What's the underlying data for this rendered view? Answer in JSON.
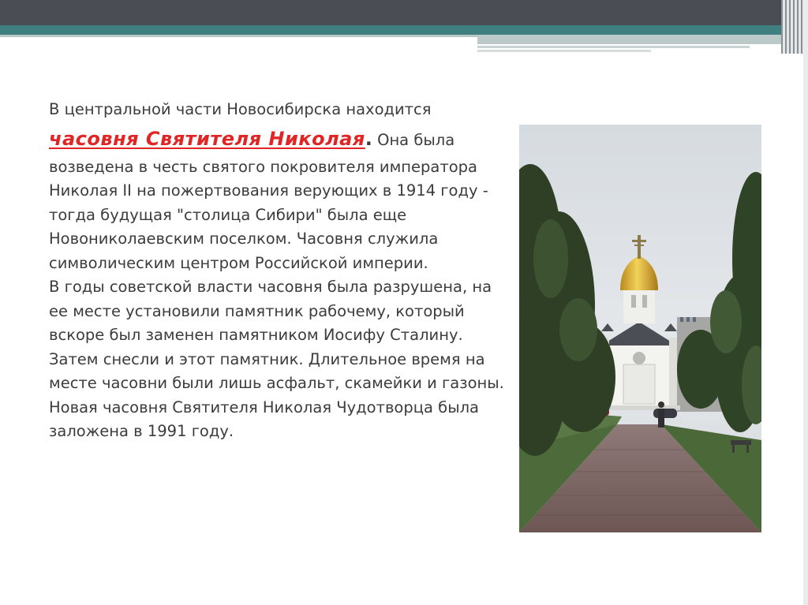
{
  "slide": {
    "intro": "В центральной части Новосибирска находится",
    "chapel_name": "часовня Святителя Николая",
    "after_name": " Она была возведена в честь святого покровителя императора Николая II на пожертвования верующих в 1914 году - тогда будущая \"столица Сибири\" была еще Новониколаевским поселком. Часовня служила символическим центром Российской империи.",
    "paragraph2": "В годы советской власти часовня была разрушена, на ее месте установили памятник рабочему, который вскоре был заменен памятником Иосифу Сталину. Затем снесли и этот памятник. Длительное время на месте часовни были лишь асфальт, скамейки и газоны. Новая часовня Святителя Николая Чудотворца была заложена в 1991 году.",
    "period": ".",
    "colors": {
      "text": "#3c3c3c",
      "highlight": "#e12424",
      "header_dark": "#4b4d55",
      "header_teal": "#3f7f80"
    }
  },
  "photo": {
    "subject": "chapel-photo"
  }
}
